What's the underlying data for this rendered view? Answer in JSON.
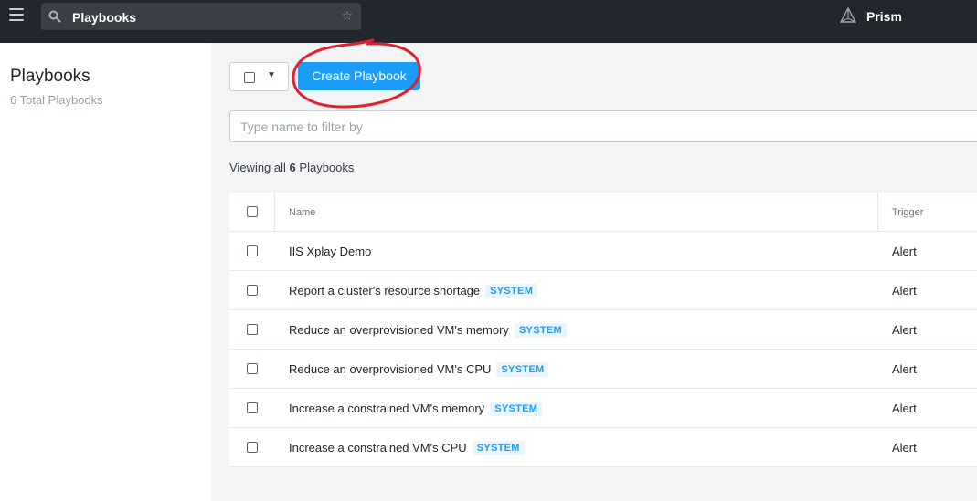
{
  "header": {
    "search_value": "Playbooks",
    "brand": "Prism"
  },
  "sidebar": {
    "title": "Playbooks",
    "subtitle": "6 Total Playbooks"
  },
  "toolbar": {
    "create_label": "Create Playbook"
  },
  "filter": {
    "placeholder": "Type name to filter by"
  },
  "summary": {
    "prefix": "Viewing all",
    "count": "6",
    "suffix": "Playbooks"
  },
  "table": {
    "columns": [
      "Name",
      "Trigger"
    ],
    "rows": [
      {
        "name": "IIS Xplay Demo",
        "badge": "",
        "trigger": "Alert"
      },
      {
        "name": "Report a cluster's resource shortage",
        "badge": "SYSTEM",
        "trigger": "Alert"
      },
      {
        "name": "Reduce an overprovisioned VM's memory",
        "badge": "SYSTEM",
        "trigger": "Alert"
      },
      {
        "name": "Reduce an overprovisioned VM's CPU",
        "badge": "SYSTEM",
        "trigger": "Alert"
      },
      {
        "name": "Increase a constrained VM's memory",
        "badge": "SYSTEM",
        "trigger": "Alert"
      },
      {
        "name": "Increase a constrained VM's CPU",
        "badge": "SYSTEM",
        "trigger": "Alert"
      }
    ]
  },
  "colors": {
    "topbar": "#22272d",
    "accent": "#1b9cf8",
    "annotation": "#e3202a"
  },
  "icons": [
    "hamburger-menu-icon",
    "search-icon",
    "star-icon",
    "prism-logo-icon",
    "chevron-down-icon"
  ]
}
